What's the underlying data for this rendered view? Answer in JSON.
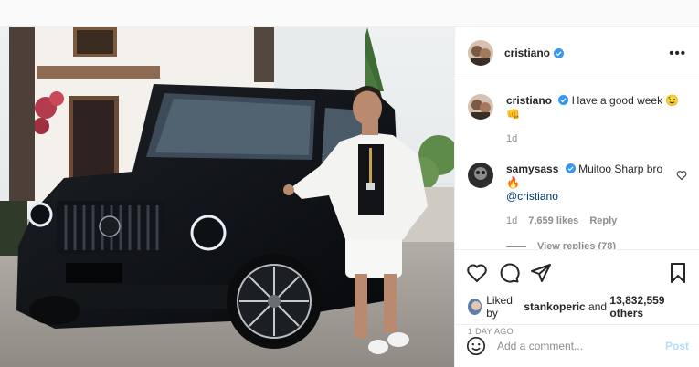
{
  "post": {
    "author": "cristiano",
    "caption": "Have a good week 😉👊",
    "caption_age": "1d"
  },
  "header": {
    "username": "cristiano",
    "more_label": "•••"
  },
  "comments": [
    {
      "username": "samysass",
      "text": "Muitoo Sharp bro 🔥",
      "mention": "@cristiano",
      "age": "1d",
      "likes": "7,659 likes",
      "reply_label": "Reply",
      "view_replies": "View replies (78)"
    }
  ],
  "likes": {
    "prefix": "Liked by",
    "first_user": "stankoperic",
    "joiner": "and",
    "others": "13,832,559 others"
  },
  "timestamp": "1 DAY AGO",
  "add_comment": {
    "placeholder": "Add a comment...",
    "post_label": "Post"
  },
  "colors": {
    "verified": "#3897f0",
    "post_button_disabled": "#b2dffc",
    "secondary_text": "#8e8e8e"
  },
  "icons": [
    "verified-badge-icon",
    "more-options-icon",
    "heart-icon",
    "comment-icon",
    "share-icon",
    "bookmark-icon",
    "emoji-icon"
  ]
}
